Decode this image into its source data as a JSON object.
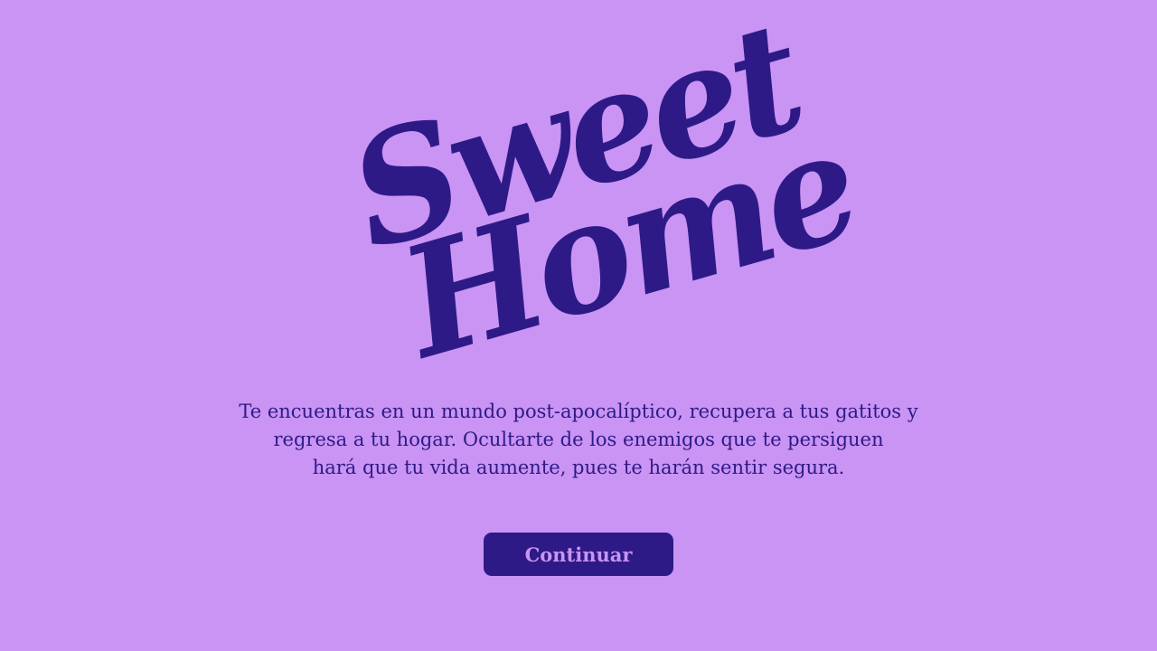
{
  "game": {
    "title_line1": "Sweet",
    "title_line2": "Home",
    "description_lines": [
      "Te encuentras en un mundo post-apocalíptico, recupera a tus gatitos y",
      "regresa a tu hogar. Ocultarte de los enemigos que te persiguen",
      "hará que tu vida aumente, pues te harán sentir segura."
    ],
    "continue_label": "Continuar"
  },
  "colors": {
    "background": "#c994f4",
    "ink": "#2e1a86"
  }
}
